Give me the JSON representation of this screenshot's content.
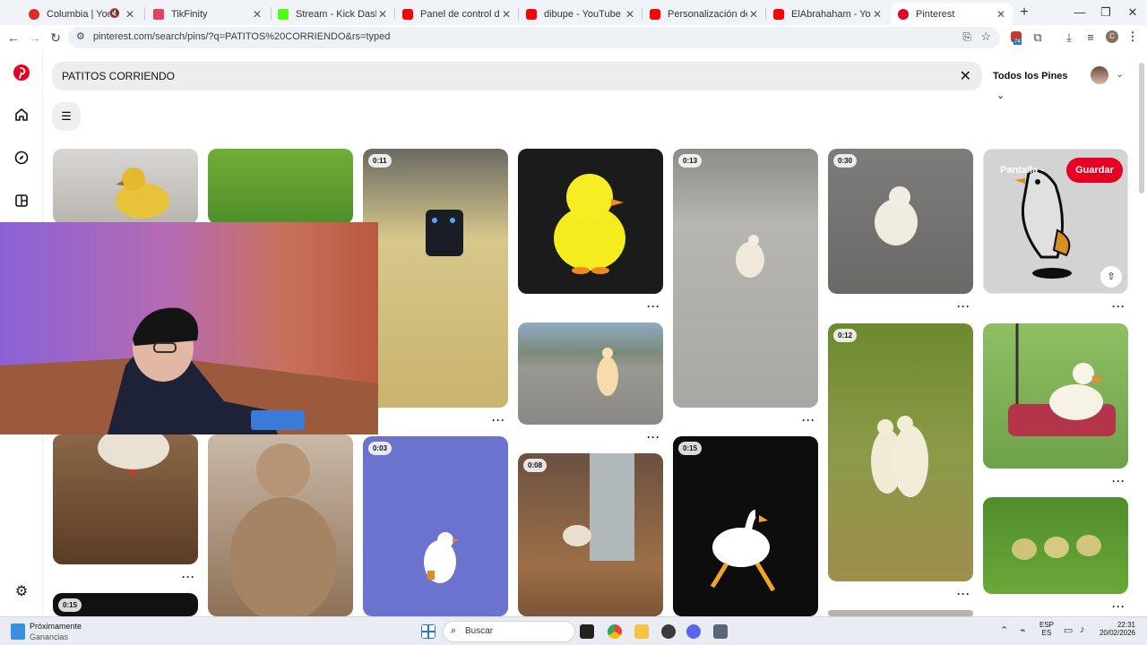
{
  "browser": {
    "tabs": [
      {
        "title": "Columbia | YouTube f",
        "favicon_color": "#e02b2b",
        "extra_icon": "speaker-muted-icon"
      },
      {
        "title": "TikFinity",
        "favicon_color": "#e4405f"
      },
      {
        "title": "Stream - Kick Dashboard",
        "favicon_color": "#53fc18"
      },
      {
        "title": "Panel de control del canal",
        "favicon_color": "#ff0000"
      },
      {
        "title": "dibupe - YouTube",
        "favicon_color": "#ff0000"
      },
      {
        "title": "Personalización del canal",
        "favicon_color": "#ff0000"
      },
      {
        "title": "ElAbrahaham - YouTube",
        "favicon_color": "#ff0000"
      },
      {
        "title": "Pinterest",
        "favicon_color": "#e60023",
        "active": true
      }
    ],
    "new_tab": "+",
    "url": "pinterest.com/search/pins/?q=PATITOS%20CORRIENDO&rs=typed",
    "extension_badge": "74",
    "profile_initial": "C"
  },
  "pinterest": {
    "search_value": "PATITOS CORRIENDO",
    "scope_label": "Todos los Pines",
    "brand_color": "#e60023",
    "hover_overlay": {
      "label": "Pantalla",
      "save_label": "Guardar"
    },
    "durations": {
      "c3a": "0:11",
      "c5a": "0:13",
      "c6a": "0:30",
      "c6b": "0:12",
      "c3b": "0:03",
      "c4c": "0:08",
      "c5b": "0:15",
      "c1c": "0:15"
    }
  },
  "taskbar": {
    "widget_title": "Próximamente",
    "widget_subtitle": "Ganancias",
    "search_placeholder": "Buscar",
    "lang_top": "ESP",
    "lang_bottom": "ES",
    "time": "22:31",
    "date": "20/02/2026"
  }
}
